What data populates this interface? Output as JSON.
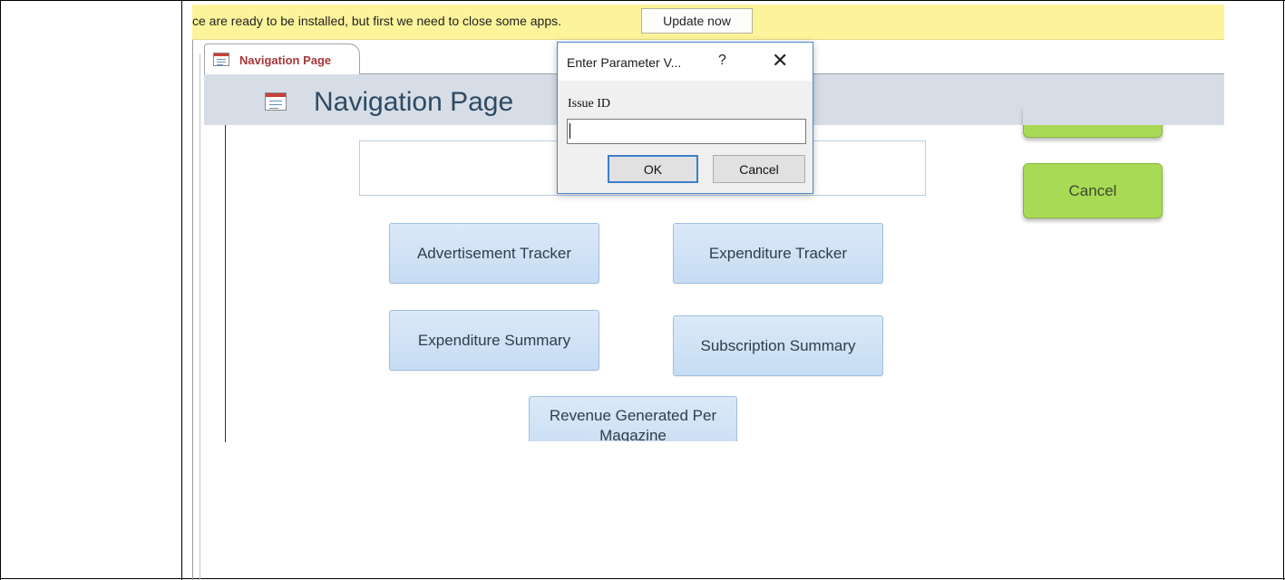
{
  "notification": {
    "message": "ce are ready to be installed, but first we need to close some apps.",
    "update_button": "Update now"
  },
  "document_tab": {
    "label": "Navigation Page",
    "icon": "form-icon"
  },
  "form": {
    "header_title": "Navigation Page",
    "buttons": {
      "advertisement_tracker": "Advertisement Tracker",
      "expenditure_tracker": "Expenditure Tracker",
      "expenditure_summary": "Expenditure Summary",
      "subscription_summary": "Subscription Summary",
      "revenue_generated": "Revenue Generated Per Magazine"
    },
    "cancel_button": "Cancel"
  },
  "dialog": {
    "title": "Enter Parameter V...",
    "help_glyph": "?",
    "close_glyph": "✕",
    "prompt_label": "Issue ID",
    "input_value": "",
    "ok_button": "OK",
    "cancel_button": "Cancel"
  },
  "colors": {
    "notification_bg": "#fdf39b",
    "header_band": "#d6dde6",
    "nav_button": "#c6dcf3",
    "green_button": "#a9da55",
    "tab_label": "#a4373a",
    "dialog_accent": "#3c7fc7"
  }
}
